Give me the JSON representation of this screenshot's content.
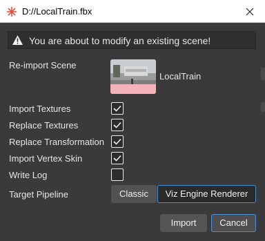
{
  "window": {
    "title": "D://LocalTrain.fbx"
  },
  "warning": {
    "text": "You are about to modify an existing scene!"
  },
  "reimport": {
    "label": "Re-import Scene",
    "scene_name": "LocalTrain"
  },
  "options": [
    {
      "label": "Import Textures",
      "checked": true
    },
    {
      "label": "Replace Textures",
      "checked": true
    },
    {
      "label": "Replace Transformation",
      "checked": true
    },
    {
      "label": "Import Vertex Skin",
      "checked": true
    },
    {
      "label": "Write Log",
      "checked": false
    }
  ],
  "pipeline": {
    "label": "Target Pipeline",
    "options": [
      "Classic",
      "Viz Engine Renderer"
    ],
    "selected": "Viz Engine Renderer"
  },
  "buttons": {
    "import": "Import",
    "cancel": "Cancel"
  },
  "colors": {
    "accent": "#4a90d9",
    "background": "#3a3a3a",
    "warning_bar": "#2f2f2f"
  }
}
